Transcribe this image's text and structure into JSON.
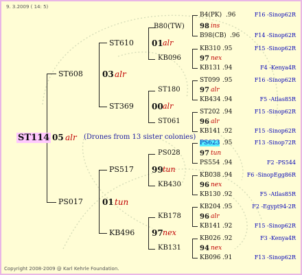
{
  "header": {
    "date": "9. 3.2009 ( 14: 5)"
  },
  "footer": {
    "copyright": "Copyright 2008-2009 @ Karl Kehrle Foundation."
  },
  "root": {
    "queen": "ST114",
    "year": "05",
    "annotation": "alr",
    "drones": "(Drones from 13 sister colonies)"
  },
  "gen1": [
    {
      "queen": "ST608",
      "year": "03",
      "annotation": "alr"
    },
    {
      "queen": "PS017",
      "year": "01",
      "annotation": "tun"
    }
  ],
  "gen2": [
    {
      "queen": "ST610",
      "year": "01",
      "annotation": "alr"
    },
    {
      "queen": "ST369",
      "year": "00",
      "annotation": "alr"
    },
    {
      "queen": "PS517",
      "year": "99",
      "annotation": "tun"
    },
    {
      "queen": "KB496",
      "year": "97",
      "annotation": "nex"
    }
  ],
  "gen3": [
    {
      "queen": "B80(TW)"
    },
    {
      "queen": "KB096"
    },
    {
      "queen": "ST180"
    },
    {
      "queen": "ST061"
    },
    {
      "queen": "PS028"
    },
    {
      "queen": "KB430"
    },
    {
      "queen": "KB178"
    },
    {
      "queen": "KB131"
    }
  ],
  "gen4": [
    {
      "mother": "B4(PK)",
      "mother_year": ".96",
      "mother_ref": "F16 -Sinop62R",
      "year": "98",
      "annotation": "ins",
      "father": "B98(CB)",
      "father_year": ".96",
      "father_ref": "F14 -Sinop62R"
    },
    {
      "mother": "KB310",
      "mother_year": ".95",
      "mother_ref": "F15 -Sinop62R",
      "year": "97",
      "annotation": "nex",
      "father": "KB131",
      "father_year": ".94",
      "father_ref": "F4 -Kenya4R"
    },
    {
      "mother": "ST099",
      "mother_year": ".95",
      "mother_ref": "F16 -Sinop62R",
      "year": "97",
      "annotation": "alr",
      "father": "KB434",
      "father_year": ".94",
      "father_ref": "F5 -Atlas85R"
    },
    {
      "mother": "ST202",
      "mother_year": ".94",
      "mother_ref": "F15 -Sinop62R",
      "year": "96",
      "annotation": "alr",
      "father": "KB141",
      "father_year": ".92",
      "father_ref": "F15 -Sinop62R"
    },
    {
      "mother": "PS623",
      "mother_year": ".95",
      "mother_ref": "F13 -Sinop72R",
      "year": "97",
      "annotation": "tun",
      "father": "PS554",
      "father_year": ".94",
      "father_ref": "F2 -PS544"
    },
    {
      "mother": "KB038",
      "mother_year": ".94",
      "mother_ref": "F6 -SinopEgg86R",
      "year": "96",
      "annotation": "nex",
      "father": "KB130",
      "father_year": ".92",
      "father_ref": "F5 -Atlas85R"
    },
    {
      "mother": "KB204",
      "mother_year": ".95",
      "mother_ref": "F2 -Egypt94-2R",
      "year": "96",
      "annotation": "alr",
      "father": "KB141",
      "father_year": ".92",
      "father_ref": "F15 -Sinop62R"
    },
    {
      "mother": "KB026",
      "mother_year": ".92",
      "mother_ref": "F3 -Kenya4R",
      "year": "94",
      "annotation": "nex",
      "father": "KB096",
      "father_year": ".91",
      "father_ref": "F13 -Sinop62R"
    }
  ],
  "colors": {
    "border": "#e9b6e6",
    "background": "#fffdd5",
    "annotation": "#c00000",
    "reference": "#0000b8",
    "root_highlight": "#ffc8ff",
    "cell_highlight": "#58f0ff"
  }
}
